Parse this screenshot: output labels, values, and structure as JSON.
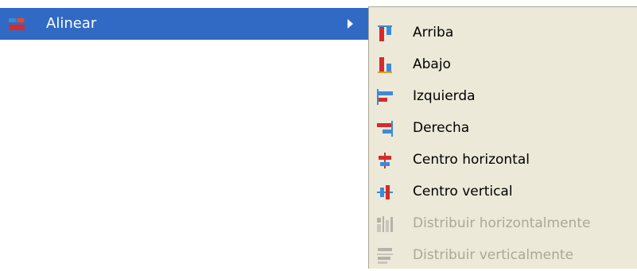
{
  "menu": {
    "parent": {
      "label": "Alinear",
      "icon": "align-menu-icon"
    },
    "submenu": [
      {
        "label": "Arriba",
        "icon": "align-top-icon",
        "enabled": true
      },
      {
        "label": "Abajo",
        "icon": "align-bottom-icon",
        "enabled": true
      },
      {
        "label": "Izquierda",
        "icon": "align-left-icon",
        "enabled": true
      },
      {
        "label": "Derecha",
        "icon": "align-right-icon",
        "enabled": true
      },
      {
        "label": "Centro horizontal",
        "icon": "align-center-horizontal-icon",
        "enabled": true
      },
      {
        "label": "Centro vertical",
        "icon": "align-center-vertical-icon",
        "enabled": true
      },
      {
        "label": "Distribuir horizontalmente",
        "icon": "distribute-horizontal-icon",
        "enabled": false
      },
      {
        "label": "Distribuir verticalmente",
        "icon": "distribute-vertical-icon",
        "enabled": false
      }
    ]
  },
  "colors": {
    "highlight": "#316ac5",
    "menu_bg": "#ece9d8",
    "disabled_text": "#aca899",
    "icon_red": "#d62b2b",
    "icon_blue": "#3c8ad8",
    "icon_gray": "#b5b2a8"
  }
}
